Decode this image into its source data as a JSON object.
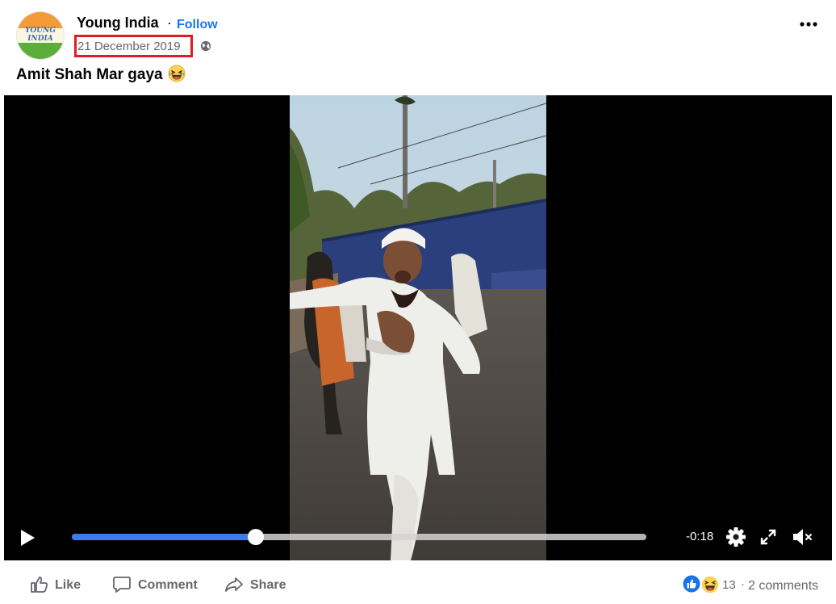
{
  "post": {
    "page_name": "Young India",
    "separator": "·",
    "follow_label": "Follow",
    "date": "21 December 2019",
    "privacy_icon": "globe-icon",
    "more_icon": "more-horizontal-icon",
    "caption": "Amit Shah Mar gaya",
    "caption_emoji": "grinning-squinting-tears-emoji",
    "avatar_text": "YOUNG INDIA",
    "colors": {
      "follow": "#1877f2",
      "date_highlight_border": "#e31b23",
      "progress_fill": "#3b7bf0"
    }
  },
  "video": {
    "progress_fraction": 0.32,
    "time_remaining": "-0:18",
    "controls": {
      "play_icon": "play-icon",
      "settings_icon": "gear-icon",
      "fullscreen_icon": "fullscreen-icon",
      "mute_icon": "volume-muted-icon"
    }
  },
  "footer": {
    "like_label": "Like",
    "comment_label": "Comment",
    "share_label": "Share",
    "reaction_count": "13",
    "dot": "·",
    "comments_count": "2 comments",
    "reaction_icons": [
      "like-reaction-icon",
      "haha-reaction-icon"
    ]
  }
}
